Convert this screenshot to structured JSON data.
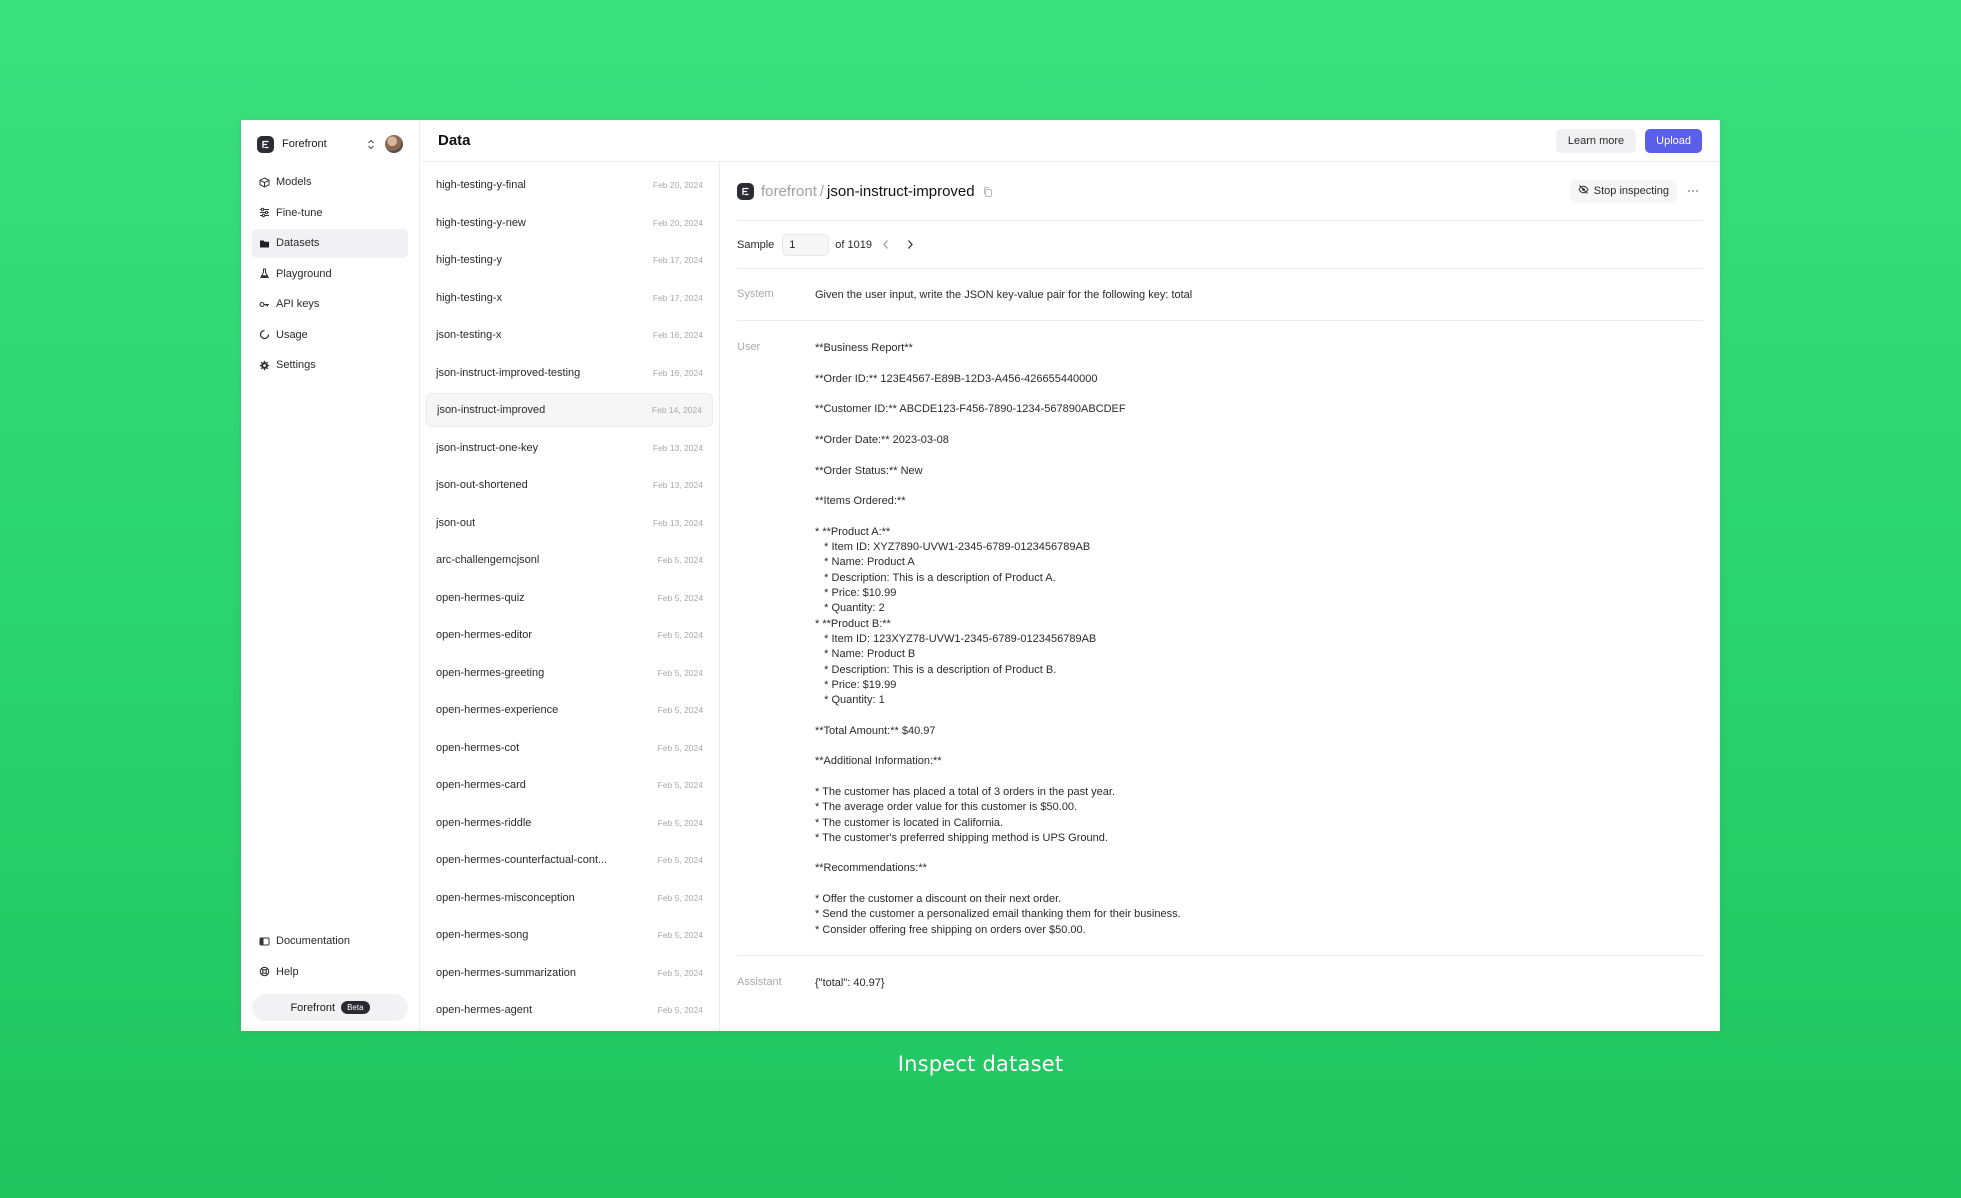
{
  "workspace": {
    "name": "Forefront"
  },
  "nav": {
    "items": [
      {
        "label": "Models",
        "icon": "cube-icon"
      },
      {
        "label": "Fine-tune",
        "icon": "sliders-icon"
      },
      {
        "label": "Datasets",
        "icon": "folder-icon"
      },
      {
        "label": "Playground",
        "icon": "flask-icon"
      },
      {
        "label": "API keys",
        "icon": "key-icon"
      },
      {
        "label": "Usage",
        "icon": "pie-icon"
      },
      {
        "label": "Settings",
        "icon": "gear-icon"
      }
    ],
    "active": "Datasets",
    "bottom": [
      {
        "label": "Documentation",
        "icon": "book-icon"
      },
      {
        "label": "Help",
        "icon": "lifebuoy-icon"
      }
    ],
    "product": {
      "label": "Forefront",
      "badge": "Beta"
    }
  },
  "header": {
    "title": "Data",
    "learn_more": "Learn more",
    "upload": "Upload"
  },
  "datasets": [
    {
      "name": "high-testing-y-final",
      "date": "Feb 20, 2024"
    },
    {
      "name": "high-testing-y-new",
      "date": "Feb 20, 2024"
    },
    {
      "name": "high-testing-y",
      "date": "Feb 17, 2024"
    },
    {
      "name": "high-testing-x",
      "date": "Feb 17, 2024"
    },
    {
      "name": "json-testing-x",
      "date": "Feb 16, 2024"
    },
    {
      "name": "json-instruct-improved-testing",
      "date": "Feb 16, 2024"
    },
    {
      "name": "json-instruct-improved",
      "date": "Feb 14, 2024"
    },
    {
      "name": "json-instruct-one-key",
      "date": "Feb 13, 2024"
    },
    {
      "name": "json-out-shortened",
      "date": "Feb 13, 2024"
    },
    {
      "name": "json-out",
      "date": "Feb 13, 2024"
    },
    {
      "name": "arc-challengemcjsonl",
      "date": "Feb 5, 2024"
    },
    {
      "name": "open-hermes-quiz",
      "date": "Feb 5, 2024"
    },
    {
      "name": "open-hermes-editor",
      "date": "Feb 5, 2024"
    },
    {
      "name": "open-hermes-greeting",
      "date": "Feb 5, 2024"
    },
    {
      "name": "open-hermes-experience",
      "date": "Feb 5, 2024"
    },
    {
      "name": "open-hermes-cot",
      "date": "Feb 5, 2024"
    },
    {
      "name": "open-hermes-card",
      "date": "Feb 5, 2024"
    },
    {
      "name": "open-hermes-riddle",
      "date": "Feb 5, 2024"
    },
    {
      "name": "open-hermes-counterfactual-cont...",
      "date": "Feb 5, 2024"
    },
    {
      "name": "open-hermes-misconception",
      "date": "Feb 5, 2024"
    },
    {
      "name": "open-hermes-song",
      "date": "Feb 5, 2024"
    },
    {
      "name": "open-hermes-summarization",
      "date": "Feb 5, 2024"
    },
    {
      "name": "open-hermes-agent",
      "date": "Feb 5, 2024"
    }
  ],
  "selected_dataset": "json-instruct-improved",
  "detail": {
    "org": "forefront",
    "separator": "/",
    "dataset": "json-instruct-improved",
    "stop_inspecting": "Stop inspecting",
    "sample_label": "Sample",
    "sample_value": "1",
    "sample_total": "of 1019",
    "messages": [
      {
        "role": "System",
        "text": "Given the user input, write the JSON key-value pair for the following key: total"
      },
      {
        "role": "User",
        "text": "**Business Report**\n\n**Order ID:** 123E4567-E89B-12D3-A456-426655440000\n\n**Customer ID:** ABCDE123-F456-7890-1234-567890ABCDEF\n\n**Order Date:** 2023-03-08\n\n**Order Status:** New\n\n**Items Ordered:**\n\n* **Product A:**\n   * Item ID: XYZ7890-UVW1-2345-6789-0123456789AB\n   * Name: Product A\n   * Description: This is a description of Product A.\n   * Price: $10.99\n   * Quantity: 2\n* **Product B:**\n   * Item ID: 123XYZ78-UVW1-2345-6789-0123456789AB\n   * Name: Product B\n   * Description: This is a description of Product B.\n   * Price: $19.99\n   * Quantity: 1\n\n**Total Amount:** $40.97\n\n**Additional Information:**\n\n* The customer has placed a total of 3 orders in the past year.\n* The average order value for this customer is $50.00.\n* The customer is located in California.\n* The customer's preferred shipping method is UPS Ground.\n\n**Recommendations:**\n\n* Offer the customer a discount on their next order.\n* Send the customer a personalized email thanking them for their business.\n* Consider offering free shipping on orders over $50.00."
      },
      {
        "role": "Assistant",
        "text": "{\"total\": 40.97}"
      }
    ]
  },
  "caption": "Inspect dataset",
  "colors": {
    "accent": "#5b5ee8",
    "background": "#2ad46f"
  }
}
